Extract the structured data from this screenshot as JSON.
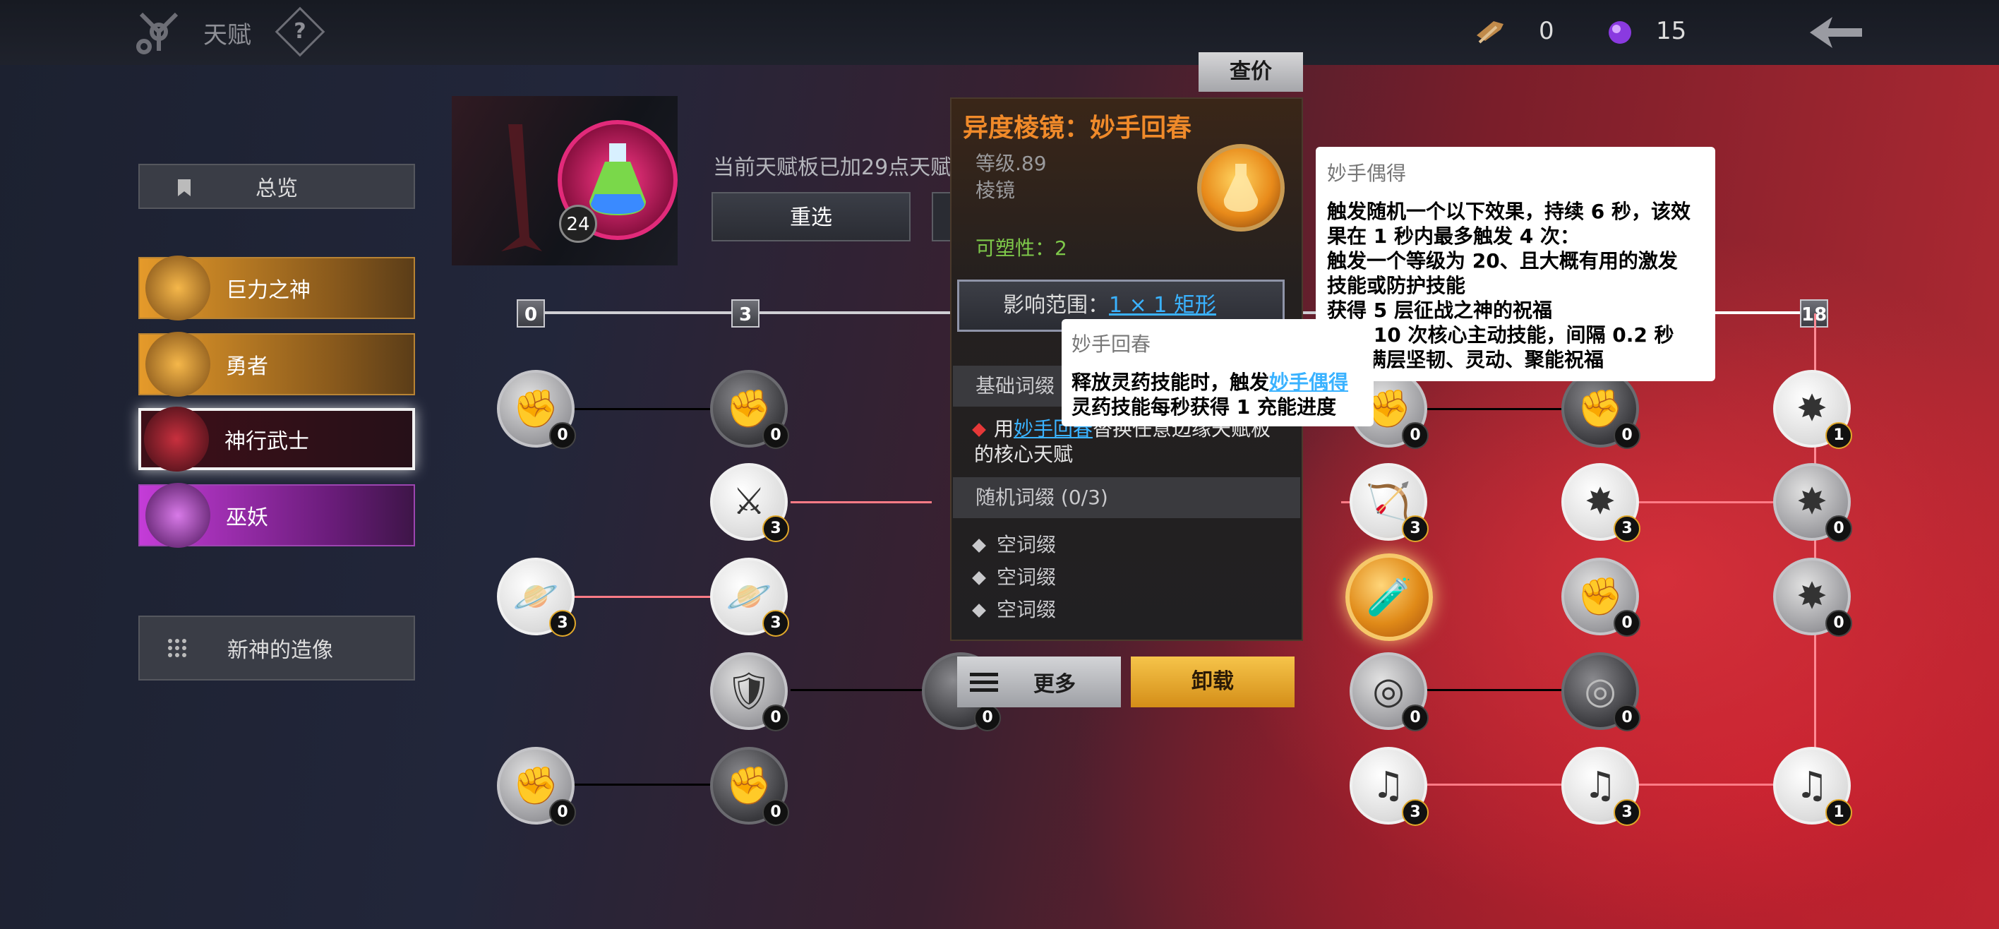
{
  "topbar": {
    "title": "天赋",
    "help_label": "?",
    "resource1": {
      "icon": "crossbow-icon",
      "value": "0"
    },
    "resource2": {
      "icon": "purple-crystal-icon",
      "value": "15"
    }
  },
  "nav": {
    "overview": "总览",
    "items": [
      {
        "label": "巨力之神",
        "style": "gold"
      },
      {
        "label": "勇者",
        "style": "gold"
      },
      {
        "label": "神行武士",
        "style": "selected-red"
      },
      {
        "label": "巫妖",
        "style": "purple"
      }
    ],
    "statue": "新神的造像"
  },
  "board": {
    "level_badge": "24",
    "description": "当前天赋板已加29点天赋",
    "reselect_label": "重选"
  },
  "track": {
    "markers": [
      "0",
      "3",
      "18"
    ]
  },
  "nodes": {
    "counts": [
      "0",
      "0",
      "3",
      "3",
      "3",
      "0",
      "0",
      "0",
      "0",
      "0",
      "3",
      "0",
      "0",
      "0",
      "3",
      "3",
      "1",
      "3",
      "0",
      "0",
      "0",
      "1",
      "0"
    ]
  },
  "card": {
    "price_label": "查价",
    "title": "异度棱镜：妙手回春",
    "level": "等级.89",
    "type": "棱镜",
    "plasticity": "可塑性：2",
    "range_label": "影响范围：",
    "range_value": "1 × 1 矩形",
    "basic_header": "基础词缀",
    "basic_prefix": "用",
    "basic_link": "妙手回春",
    "basic_suffix": "替换任意边缘天赋板的核心天赋",
    "random_header": "随机词缀 (0/3)",
    "random_affixes": [
      "空词缀",
      "空词缀",
      "空词缀"
    ],
    "more_label": "更多",
    "unload_label": "卸载"
  },
  "tooltip_miaoshou_huichun": {
    "title": "妙手回春",
    "line1_prefix": "释放灵药技能时，触发",
    "line1_link": "妙手偶得",
    "line2": "灵药技能每秒获得 1 充能进度"
  },
  "tooltip_miaoshou_oude": {
    "title": "妙手偶得",
    "lines": [
      "触发随机一个以下效果，持续 6 秒，该效",
      "果在 1 秒内最多触发 4 次：",
      "触发一个等级为 20、且大概有用的激发",
      "技能或防护技能",
      "获得 5 层征战之神的祝福",
      "触发 10 次核心主动技能，间隔 0.2 秒",
      "获得满层坚韧、灵动、聚能祝福"
    ]
  }
}
